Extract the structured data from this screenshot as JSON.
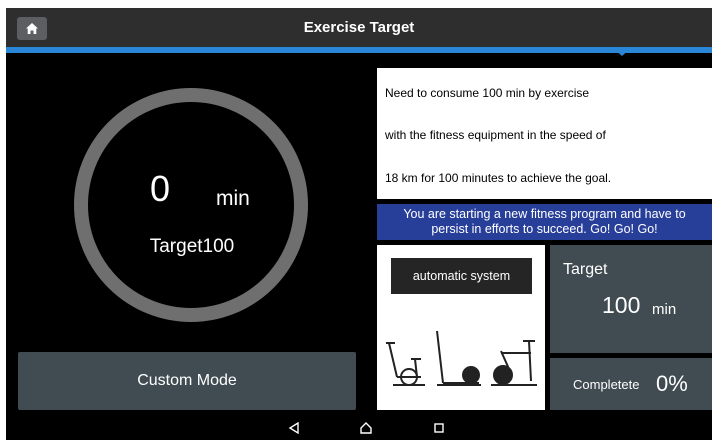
{
  "header": {
    "title": "Exercise Target",
    "home_icon": "home-icon"
  },
  "progress_ring": {
    "value": "0",
    "unit": "min",
    "target_text": "Target100",
    "progress": 0
  },
  "custom_mode": {
    "label": "Custom Mode"
  },
  "info": {
    "line1": "Need to consume  100  min by exercise",
    "line2": "with the fitness equipment in the speed of",
    "line3": "18  km for  100  minutes to achieve the goal."
  },
  "motivation": {
    "text_line1": "You are starting a new fitness program and have to",
    "text_line2": "persist in efforts to succeed. Go! Go! Go!"
  },
  "equipment": {
    "auto_system_label": "automatic system",
    "icons": [
      "exercise-bike-icon",
      "elliptical-icon",
      "spin-bike-icon"
    ]
  },
  "target": {
    "label": "Target",
    "value": "100",
    "unit": "min"
  },
  "completion": {
    "label": "Completete",
    "value": "0%"
  },
  "nav": {
    "icons": [
      "back-icon",
      "home-icon",
      "recents-icon"
    ]
  },
  "colors": {
    "accent_blue": "#2a87d8",
    "banner_blue": "#283f9a",
    "panel": "#404b52",
    "ring": "#6f6f6f"
  }
}
